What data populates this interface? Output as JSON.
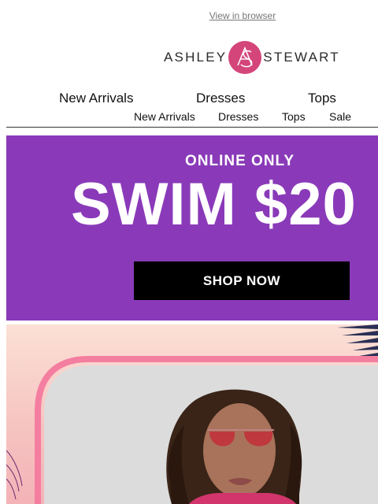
{
  "header": {
    "view_in_browser": "View in browser"
  },
  "logo": {
    "left_text": "ASHLEY",
    "right_text": "STEWART",
    "monogram_icon": "as-monogram-icon",
    "brand_color": "#d4457a"
  },
  "nav_primary": [
    "New Arrivals",
    "Dresses",
    "Tops"
  ],
  "nav_secondary": [
    "New Arrivals",
    "Dresses",
    "Tops",
    "Sale"
  ],
  "promo": {
    "eyebrow": "ONLINE ONLY",
    "headline": "SWIM $20",
    "cta": "SHOP NOW",
    "background": "#8a3ab9"
  },
  "hero": {
    "frame_color": "#f47ea0"
  }
}
